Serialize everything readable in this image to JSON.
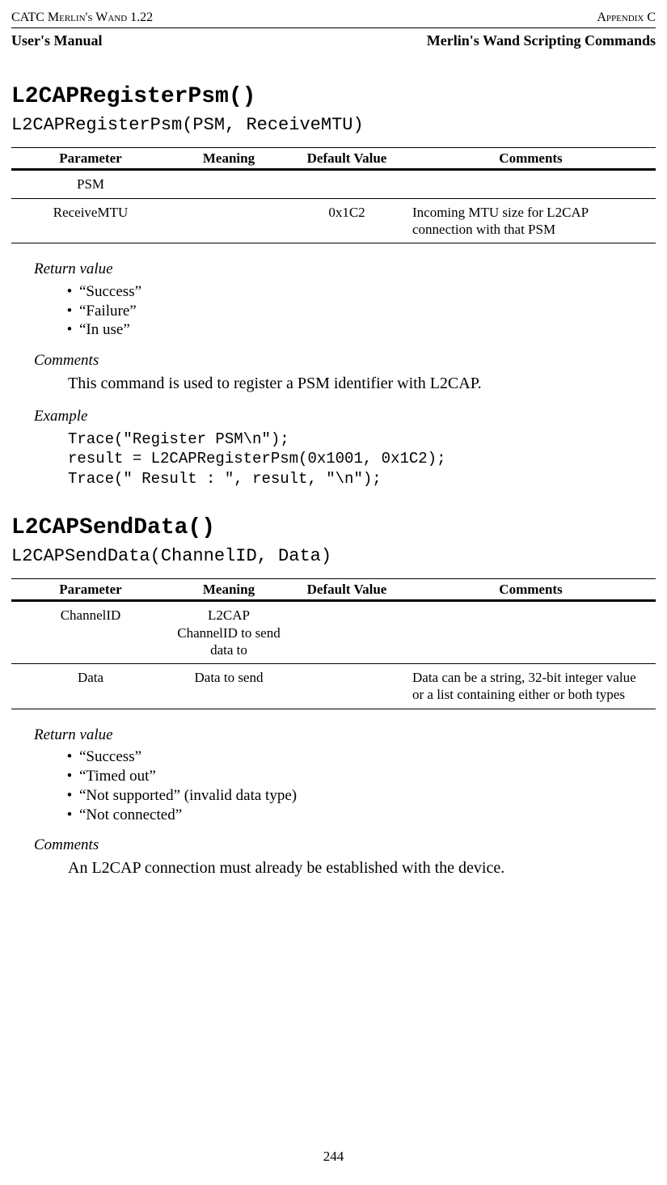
{
  "header": {
    "top_left": "CATC Merlin's Wand 1.22",
    "top_right": "Appendix C",
    "row2_left": "User's Manual",
    "row2_right": "Merlin's Wand Scripting Commands"
  },
  "cmd1": {
    "title": "L2CAPRegisterPsm()",
    "signature": "L2CAPRegisterPsm(PSM, ReceiveMTU)",
    "table": {
      "headers": {
        "param": "Parameter",
        "meaning": "Meaning",
        "default": "Default Value",
        "comments": "Comments"
      },
      "rows": [
        {
          "param": "PSM",
          "meaning": "",
          "default": "",
          "comments": ""
        },
        {
          "param": "ReceiveMTU",
          "meaning": "",
          "default": "0x1C2",
          "comments": "Incoming MTU size for L2CAP connection with that PSM"
        }
      ]
    },
    "return_label": "Return value",
    "returns": [
      "“Success”",
      "“Failure”",
      "“In use”"
    ],
    "comments_label": "Comments",
    "comments_body": "This command is used to register a PSM identifier with L2CAP.",
    "example_label": "Example",
    "example_code": "Trace(\"Register PSM\\n\");\nresult = L2CAPRegisterPsm(0x1001, 0x1C2);\nTrace(\" Result : \", result, \"\\n\");"
  },
  "cmd2": {
    "title": "L2CAPSendData()",
    "signature": "L2CAPSendData(ChannelID, Data)",
    "table": {
      "headers": {
        "param": "Parameter",
        "meaning": "Meaning",
        "default": "Default Value",
        "comments": "Comments"
      },
      "rows": [
        {
          "param": "ChannelID",
          "meaning": "L2CAP ChannelID to send data to",
          "default": "",
          "comments": ""
        },
        {
          "param": "Data",
          "meaning": "Data to send",
          "default": "",
          "comments": "Data can be a string, 32-bit integer value or a list containing either or both types"
        }
      ]
    },
    "return_label": "Return value",
    "returns": [
      "“Success”",
      "“Timed out”",
      "“Not supported” (invalid data type)",
      "“Not connected”"
    ],
    "comments_label": "Comments",
    "comments_body": "An L2CAP connection must already be established with the device."
  },
  "page_number": "244"
}
